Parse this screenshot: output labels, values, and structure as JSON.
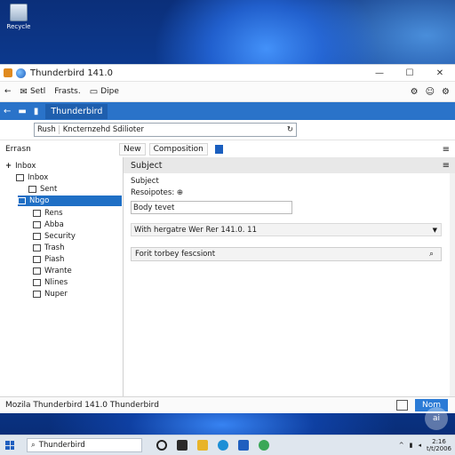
{
  "desktop": {
    "recycle_label": "Recycle"
  },
  "window": {
    "title": "Thunderbird 141.0",
    "controls": [
      "—",
      "☐",
      "✕"
    ]
  },
  "menubar": {
    "back": "←",
    "items": [
      "Setl",
      "Frasts.",
      "Dipe"
    ],
    "right_icons": [
      "⚙",
      "☺",
      "⚙"
    ]
  },
  "tabbar": {
    "tab_label": "Thunderbird"
  },
  "address": {
    "label": "Rush",
    "value": "Kncternzehd Sdilioter",
    "reload": "↻"
  },
  "toolbar": {
    "left_label": "Errasn",
    "buttons": [
      "New",
      "Composition"
    ],
    "more": "≡"
  },
  "sidebar": {
    "folders": [
      {
        "label": "Inbox"
      },
      {
        "label": "Inbox"
      },
      {
        "label": "Sent"
      },
      {
        "label": "Nbgo"
      },
      {
        "label": "Rens"
      },
      {
        "label": "Abba"
      },
      {
        "label": "Security"
      },
      {
        "label": "Trash"
      },
      {
        "label": "Piash"
      },
      {
        "label": "Wrante"
      },
      {
        "label": "Nlines"
      },
      {
        "label": "Nuper"
      }
    ]
  },
  "main": {
    "header": "Subject",
    "menu": "≡",
    "subject_label": "Subject",
    "recipients_label": "Resoipotes: ⊕",
    "body_value": "Body tevet",
    "select_value": "With hergatre Wer Rer 141.0. 11",
    "search_placeholder": "Forit torbey fescsiont"
  },
  "statusbar": {
    "text": "Mozila Thunderbird 141.0 Thunderbird",
    "button": "Nom"
  },
  "taskbar": {
    "search_text": "Thunderbird",
    "clock_time": "2:16",
    "clock_date": "t/t/2006",
    "ai": "ai"
  }
}
